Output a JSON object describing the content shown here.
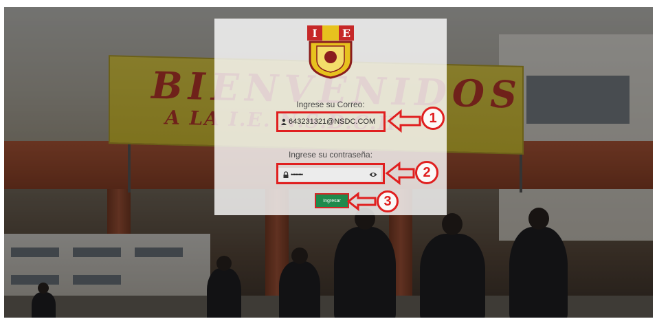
{
  "banner": {
    "line1": "BIENVENIDOS",
    "line2": "A LA I.E. N.S.D.C.H."
  },
  "logo": {
    "letter_left": "I",
    "letter_right": "E"
  },
  "form": {
    "email_label": "Ingrese su Correo:",
    "email_value": "643231321@NSDC.COM",
    "email_icon": "user-icon",
    "password_label": "Ingrese su contraseña:",
    "password_value": "••••••••",
    "password_icon": "lock-icon",
    "show_password_icon": "eye-icon",
    "submit_label": "Ingresar"
  },
  "annotations": {
    "step1": "1",
    "step2": "2",
    "step3": "3"
  },
  "colors": {
    "annotation_red": "#e01f1f",
    "button_green": "#1f8a4c"
  }
}
